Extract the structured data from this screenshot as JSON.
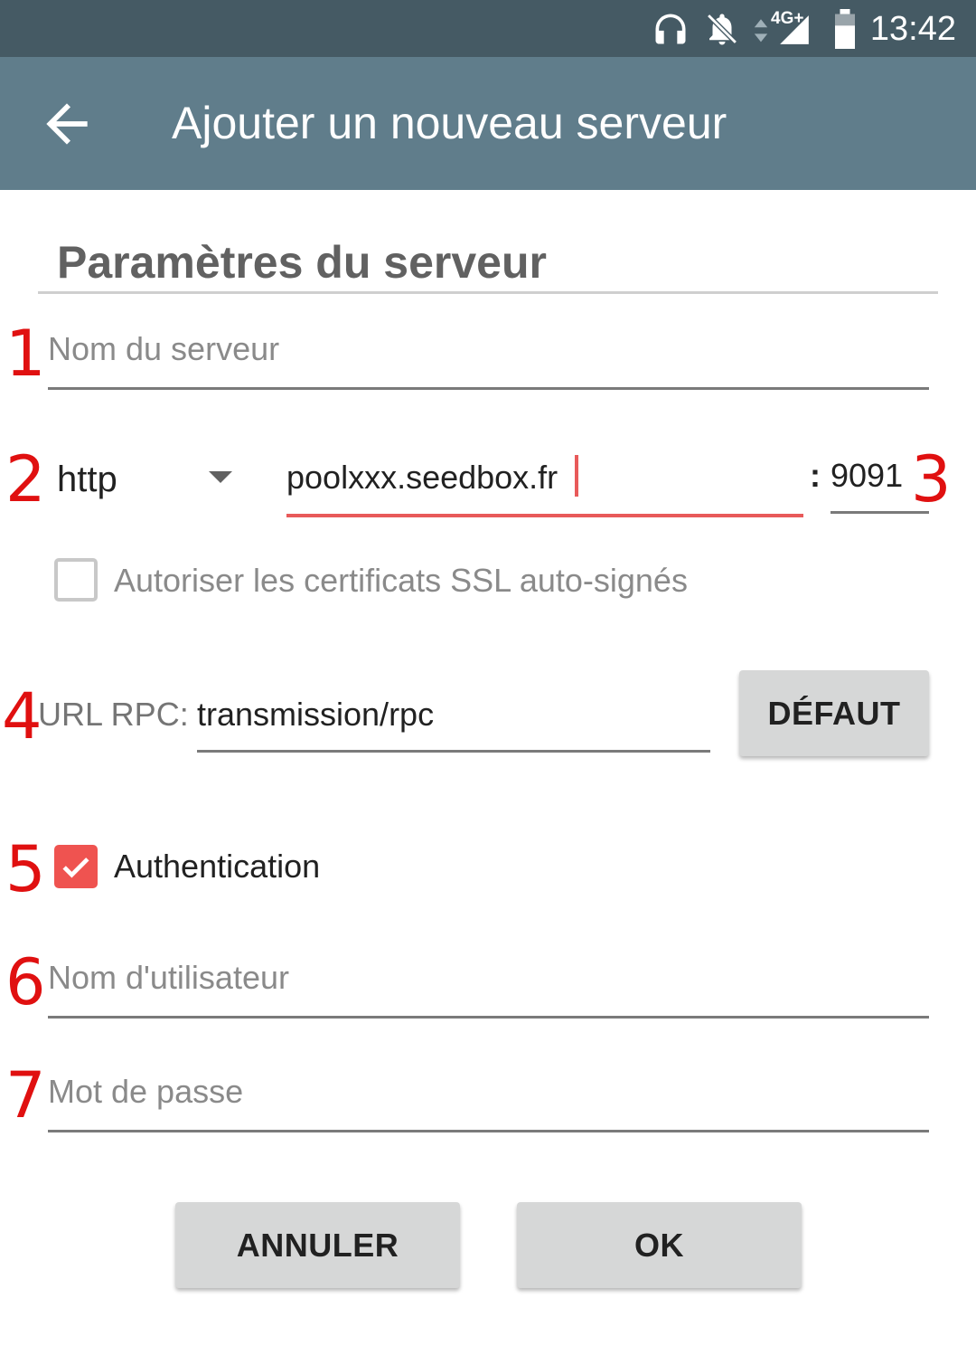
{
  "status_bar": {
    "time": "13:42",
    "network": "4G+",
    "icons": [
      "headphones-icon",
      "notifications-off-icon",
      "signal-icon",
      "battery-icon"
    ]
  },
  "app_bar": {
    "back_icon": "arrow-back-icon",
    "title": "Ajouter un nouveau serveur"
  },
  "section": {
    "title": "Paramètres du serveur"
  },
  "annotations": [
    "1",
    "2",
    "3",
    "4",
    "5",
    "6",
    "7"
  ],
  "form": {
    "server_name": {
      "placeholder": "Nom du serveur",
      "value": ""
    },
    "protocol": {
      "selected": "http"
    },
    "host": {
      "value": "poolxxx.seedbox.fr"
    },
    "port": {
      "separator": ":",
      "value": "9091"
    },
    "ssl": {
      "label": "Autoriser les certificats SSL auto-signés",
      "checked": false
    },
    "rpc": {
      "label": "URL RPC:",
      "value": "transmission/rpc",
      "default_button": "DÉFAUT"
    },
    "auth": {
      "label": "Authentication",
      "checked": true
    },
    "username": {
      "placeholder": "Nom d'utilisateur",
      "value": ""
    },
    "password": {
      "placeholder": "Mot de passe",
      "value": ""
    }
  },
  "actions": {
    "cancel": "ANNULER",
    "ok": "OK"
  },
  "colors": {
    "status_bar": "#455a64",
    "app_bar": "#607d8b",
    "accent": "#ef5350",
    "annotation": "#e01010"
  }
}
